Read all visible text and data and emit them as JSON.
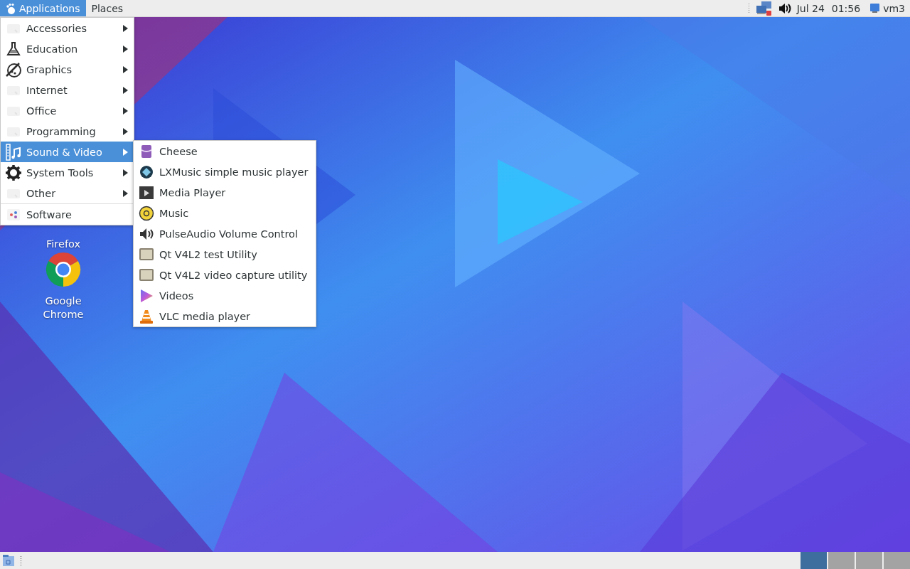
{
  "top_panel": {
    "menus": [
      {
        "label": "Applications",
        "selected": true
      },
      {
        "label": "Places",
        "selected": false
      }
    ],
    "date": "Jul 24",
    "time": "01:56",
    "user": "vm3"
  },
  "applications_menu": {
    "categories": [
      {
        "label": "Accessories",
        "selected": false
      },
      {
        "label": "Education",
        "selected": false
      },
      {
        "label": "Graphics",
        "selected": false
      },
      {
        "label": "Internet",
        "selected": false
      },
      {
        "label": "Office",
        "selected": false
      },
      {
        "label": "Programming",
        "selected": false
      },
      {
        "label": "Sound & Video",
        "selected": true
      },
      {
        "label": "System Tools",
        "selected": false
      },
      {
        "label": "Other",
        "selected": false
      }
    ],
    "footer_items": [
      {
        "label": "Software"
      }
    ]
  },
  "submenu": {
    "items": [
      {
        "label": "Cheese"
      },
      {
        "label": "LXMusic simple music player"
      },
      {
        "label": "Media Player"
      },
      {
        "label": "Music"
      },
      {
        "label": "PulseAudio Volume Control"
      },
      {
        "label": "Qt V4L2 test Utility"
      },
      {
        "label": "Qt V4L2 video capture utility"
      },
      {
        "label": "Videos"
      },
      {
        "label": "VLC media player"
      }
    ]
  },
  "desktop_icons": [
    {
      "label": "Firefox",
      "kind": "hidden"
    },
    {
      "label": "Google Chrome",
      "kind": "chrome"
    }
  ],
  "bottom_panel": {
    "workspaces": [
      {
        "selected": true
      },
      {
        "selected": false
      },
      {
        "selected": false
      },
      {
        "selected": false
      }
    ]
  }
}
